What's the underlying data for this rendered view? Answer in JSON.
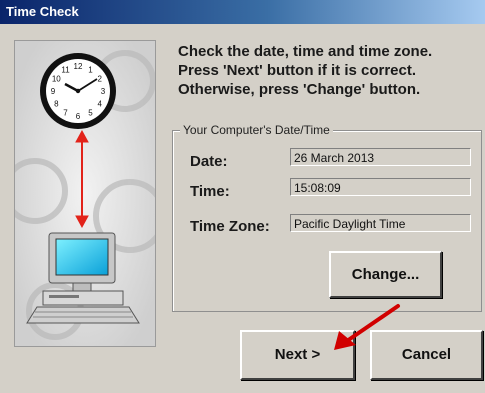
{
  "window": {
    "title": "Time Check"
  },
  "instructions": [
    "Check the date, time and time zone.",
    "Press 'Next' button if it is correct.",
    "Otherwise, press 'Change' button."
  ],
  "group": {
    "legend": "Your Computer's Date/Time",
    "fields": [
      {
        "label": "Date:",
        "value": "26 March 2013"
      },
      {
        "label": "Time:",
        "value": "15:08:09"
      },
      {
        "label": "Time Zone:",
        "value": "Pacific Daylight Time"
      }
    ]
  },
  "buttons": {
    "change": "Change...",
    "next": "Next >",
    "cancel": "Cancel"
  },
  "clock": {
    "numerals": [
      "12",
      "1",
      "2",
      "3",
      "4",
      "5",
      "6",
      "7",
      "8",
      "9",
      "10",
      "11"
    ]
  },
  "colors": {
    "arrow": "#e2231a",
    "title_bar": "#0a246a"
  }
}
